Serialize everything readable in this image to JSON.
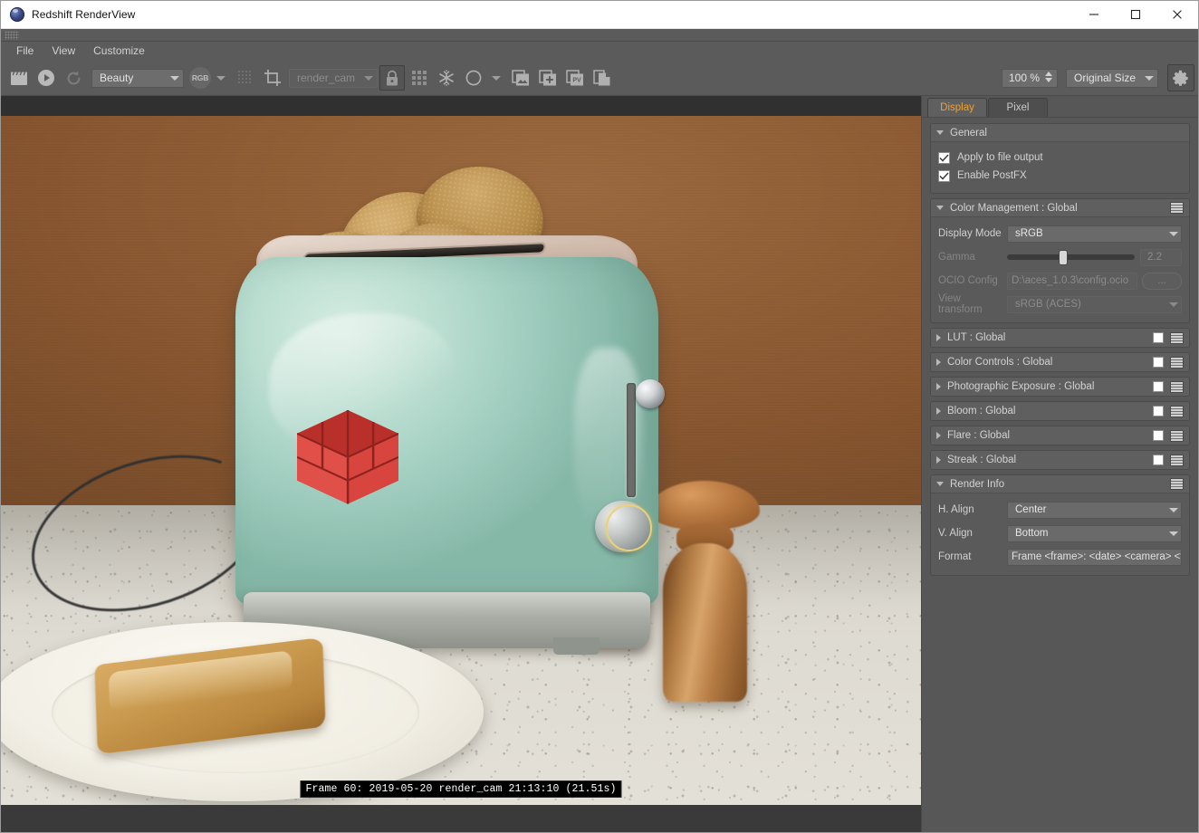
{
  "window": {
    "title": "Redshift RenderView",
    "app_icon": "redshift-logo-icon",
    "minimize": "minimize-icon",
    "maximize": "maximize-icon",
    "close": "close-icon"
  },
  "menubar": {
    "items": [
      "File",
      "View",
      "Customize"
    ]
  },
  "toolbar": {
    "render_icon": "clapperboard-icon",
    "play_icon": "play-icon",
    "refresh_icon": "refresh-icon",
    "aov_value": "Beauty",
    "channel_badge": "RGB",
    "alpha_icon": "alpha-grid-icon",
    "crop_icon": "crop-region-icon",
    "camera_value": "render_cam",
    "lock_icon": "lock-icon",
    "grid_icon": "grid-icon",
    "snowflake_icon": "snapshot-freeze-icon",
    "circle_icon": "circle-icon",
    "image_icon": "image-stack-icon",
    "add_image_icon": "add-image-icon",
    "pv_icon": "pv-badge-icon",
    "copy_icon": "copy-page-icon",
    "zoom_value": "100 %",
    "size_value": "Original Size",
    "settings_icon": "gear-icon"
  },
  "render_view": {
    "frame_info": "Frame  60:  2019-05-20  render_cam  21:13:10  (21.51s)",
    "scene_description": "Mint green retro toaster with four toast slices on a speckled granite countertop, copper pepper mills at right, white plate with a slice of toast at lower left, warm brown wall background",
    "colors": {
      "wall": "#8b5a33",
      "counter": "#dedbd2",
      "toaster": "#a4d0c2",
      "logo_cube": "#d8453f",
      "mill": "#b87840",
      "plate": "#f6f3ea",
      "toast": "#c39a57"
    }
  },
  "side_panel": {
    "tabs": [
      {
        "label": "Display",
        "active": true
      },
      {
        "label": "Pixel",
        "active": false
      }
    ],
    "general": {
      "title": "General",
      "expanded": true,
      "checkboxes": [
        {
          "label": "Apply to file output",
          "checked": true
        },
        {
          "label": "Enable PostFX",
          "checked": true
        }
      ]
    },
    "color_management": {
      "title": "Color Management  : Global",
      "expanded": true,
      "menu_icon": "hamburger-menu-icon",
      "display_mode": {
        "label": "Display Mode",
        "value": "sRGB",
        "enabled": true
      },
      "gamma": {
        "label": "Gamma",
        "value": "2.2",
        "slider_pct": 41,
        "enabled": false
      },
      "ocio_config": {
        "label": "OCIO Config",
        "value": "D:\\aces_1.0.3\\config.ocio",
        "browse": "...",
        "enabled": false
      },
      "view_transform": {
        "label": "View transform",
        "value": "sRGB (ACES)",
        "enabled": false
      }
    },
    "collapsed_groups": [
      {
        "title": "LUT  : Global",
        "checkbox": false,
        "menu_icon": "hamburger-menu-icon"
      },
      {
        "title": "Color Controls  : Global",
        "checkbox": false,
        "menu_icon": "hamburger-menu-icon"
      },
      {
        "title": "Photographic Exposure  : Global",
        "checkbox": false,
        "menu_icon": "hamburger-menu-icon"
      },
      {
        "title": "Bloom  : Global",
        "checkbox": false,
        "menu_icon": "hamburger-menu-icon"
      },
      {
        "title": "Flare  : Global",
        "checkbox": false,
        "menu_icon": "hamburger-menu-icon"
      },
      {
        "title": "Streak  : Global",
        "checkbox": false,
        "menu_icon": "hamburger-menu-icon"
      }
    ],
    "render_info": {
      "title": "Render Info",
      "expanded": true,
      "menu_icon": "hamburger-menu-icon",
      "h_align": {
        "label": "H. Align",
        "value": "Center"
      },
      "v_align": {
        "label": "V. Align",
        "value": "Bottom"
      },
      "format": {
        "label": "Format",
        "value": "Frame <frame>: <date> <camera> <tim"
      }
    }
  }
}
